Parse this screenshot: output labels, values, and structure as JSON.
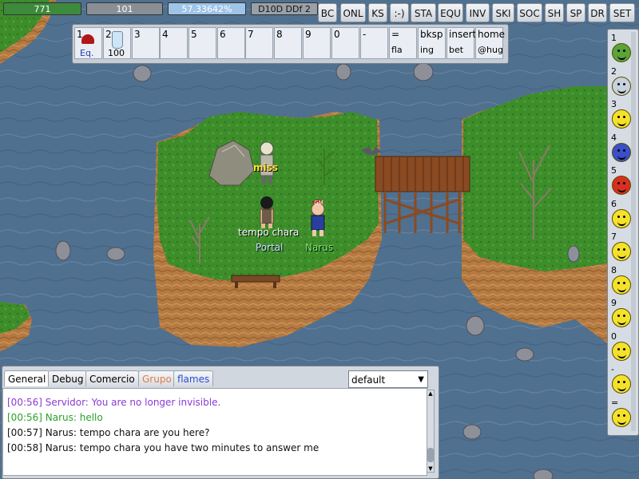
{
  "status_bars": {
    "hp": "771",
    "mp": "101",
    "xp": "57.33642%",
    "job": "D10D DDf 2"
  },
  "top_buttons": [
    "BC",
    "ONL",
    "KS",
    ":-)",
    "STA",
    "EQU",
    "INV",
    "SKI",
    "SOC",
    "SH",
    "SP",
    "DR",
    "SET"
  ],
  "shortcuts": [
    {
      "key": "1",
      "label": "Eq.",
      "icon": "gm-cap-icon"
    },
    {
      "key": "2",
      "label": "100",
      "icon": "potion-bottle-icon"
    },
    {
      "key": "3",
      "label": ""
    },
    {
      "key": "4",
      "label": ""
    },
    {
      "key": "5",
      "label": ""
    },
    {
      "key": "6",
      "label": ""
    },
    {
      "key": "7",
      "label": ""
    },
    {
      "key": "8",
      "label": ""
    },
    {
      "key": "9",
      "label": ""
    },
    {
      "key": "0",
      "label": ""
    },
    {
      "key": "-",
      "label": ""
    },
    {
      "key": "=",
      "label": "fla"
    },
    {
      "key": "bksp",
      "label": "ing"
    },
    {
      "key": "insert",
      "label": "bet"
    },
    {
      "key": "home",
      "label": "@hug"
    }
  ],
  "emotes": [
    {
      "key": "1",
      "color": "#5aa43a",
      "name": "sick-face-icon"
    },
    {
      "key": "2",
      "color": "#c8d2dc",
      "name": "grey-face-icon"
    },
    {
      "key": "3",
      "color": "#f4e22a",
      "name": "smile-face-icon"
    },
    {
      "key": "4",
      "color": "#3a4fc8",
      "name": "blue-face-icon"
    },
    {
      "key": "5",
      "color": "#d83020",
      "name": "angry-face-icon"
    },
    {
      "key": "6",
      "color": "#f4e22a",
      "name": "grin-face-icon"
    },
    {
      "key": "7",
      "color": "#f4e22a",
      "name": "halo-face-icon"
    },
    {
      "key": "8",
      "color": "#f4e22a",
      "name": "annoyed-face-icon"
    },
    {
      "key": "9",
      "color": "#f4e22a",
      "name": "wink-face-icon"
    },
    {
      "key": "0",
      "color": "#f4e22a",
      "name": "laugh-face-icon"
    },
    {
      "key": "-",
      "color": "#f4e22a",
      "name": "tongue-face-icon"
    },
    {
      "key": "=",
      "color": "#f4e22a",
      "name": "cool-face-icon"
    }
  ],
  "world": {
    "miss_text": "miss",
    "npc_name": "tempo chara",
    "portal_name": "Portal",
    "player_name": "Narus",
    "gm_badge": "GM"
  },
  "chat": {
    "tabs": [
      "General",
      "Debug",
      "Comercio",
      "Grupo",
      "flames"
    ],
    "channel_select": "default",
    "lines": [
      {
        "text": "[00:56] Servidor: You are no longer invisible.",
        "color": "#8a3ad6"
      },
      {
        "text": "[00:56] Narus: hello",
        "color": "#2aa02a"
      },
      {
        "text": "[00:57] Narus: tempo chara are you here?",
        "color": "#111111"
      },
      {
        "text": "[00:58] Narus: tempo chara you have two minutes to answer me",
        "color": "#111111"
      }
    ]
  },
  "colors": {
    "water": "#4f6f8f",
    "grass": "#3c8c2a",
    "cliff": "#b57a42",
    "hp_bar": "#3d8a3d",
    "mp_bar": "#8a8f96",
    "xp_bar": "#9fc4e8",
    "tab_grupo": "#e07b4a",
    "tab_flames": "#2a4fd6"
  }
}
